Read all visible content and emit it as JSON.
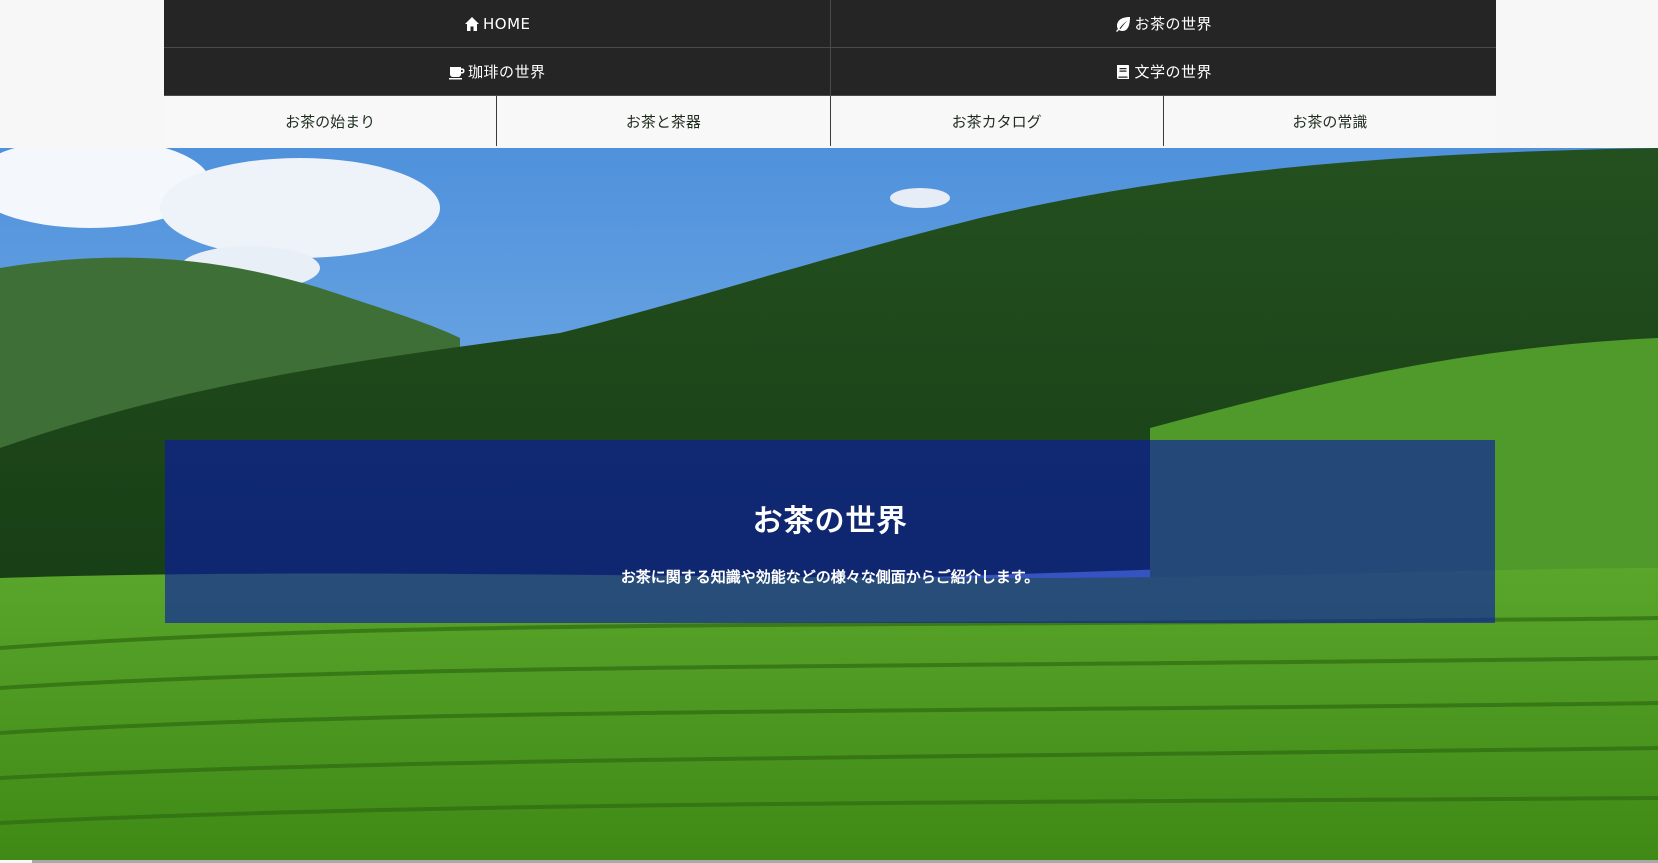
{
  "nav": {
    "home": {
      "label": "HOME",
      "icon": "home-icon"
    },
    "tea_world": {
      "label": "お茶の世界",
      "icon": "leaf-icon"
    },
    "coffee_world": {
      "label": "珈琲の世界",
      "icon": "mug-icon"
    },
    "literature_world": {
      "label": "文学の世界",
      "icon": "book-icon"
    }
  },
  "subnav": [
    {
      "label": "お茶の始まり"
    },
    {
      "label": "お茶と茶器"
    },
    {
      "label": "お茶カタログ"
    },
    {
      "label": "お茶の常識"
    }
  ],
  "hero": {
    "title": "お茶の世界",
    "subtitle": "お茶に関する知識や効能などの様々な側面からご紹介します。"
  }
}
